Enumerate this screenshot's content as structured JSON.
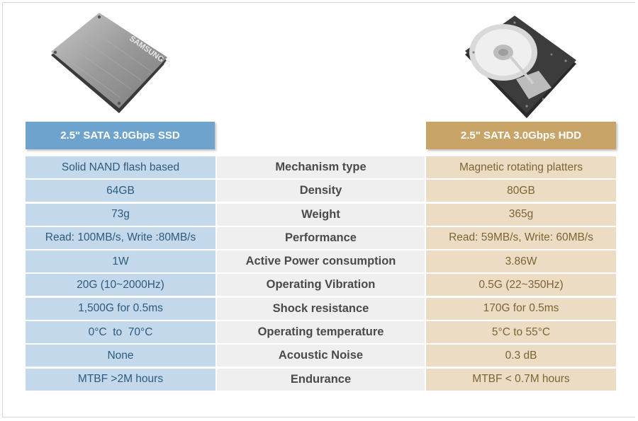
{
  "ssd": {
    "header": "2.5\" SATA 3.0Gbps SSD",
    "image_label": "SAMSUNG FlashSSD",
    "color": "#6ea3cd"
  },
  "hdd": {
    "header": "2.5\" SATA 3.0Gbps HDD",
    "color": "#c9a468"
  },
  "rows": [
    {
      "ssd": "Solid NAND flash based",
      "label": "Mechanism type",
      "hdd": "Magnetic rotating platters"
    },
    {
      "ssd": "64GB",
      "label": "Density",
      "hdd": "80GB"
    },
    {
      "ssd": "73g",
      "label": "Weight",
      "hdd": "365g"
    },
    {
      "ssd": "Read: 100MB/s, Write :80MB/s",
      "label": "Performance",
      "hdd": "Read: 59MB/s, Write: 60MB/s"
    },
    {
      "ssd": "1W",
      "label": "Active Power consumption",
      "hdd": "3.86W"
    },
    {
      "ssd": "20G (10~2000Hz)",
      "label": "Operating Vibration",
      "hdd": "0.5G (22~350Hz)"
    },
    {
      "ssd": "1,500G for 0.5ms",
      "label": "Shock resistance",
      "hdd": "170G for 0.5ms"
    },
    {
      "ssd": "0°C  to  70°C",
      "label": "Operating temperature",
      "hdd": "5°C to 55°C"
    },
    {
      "ssd": "None",
      "label": "Acoustic Noise",
      "hdd": "0.3 dB"
    },
    {
      "ssd": "MTBF >2M hours",
      "label": "Endurance",
      "hdd": "MTBF < 0.7M hours"
    }
  ]
}
